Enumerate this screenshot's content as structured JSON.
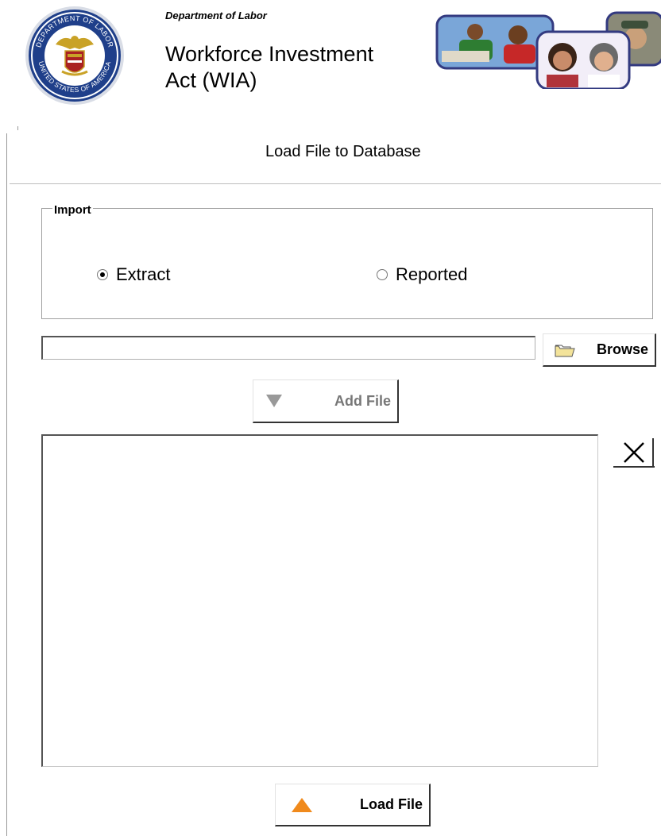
{
  "header": {
    "seal_text_top": "DEPARTMENT OF LABOR",
    "seal_text_bottom": "UNITED STATES OF AMERICA",
    "department": "Department of Labor",
    "title_line1": "Workforce Investment",
    "title_line2": "Act (WIA)"
  },
  "form": {
    "title": "Load File to Database",
    "import_group": {
      "legend": "Import",
      "options": [
        {
          "label": "Extract",
          "selected": true
        },
        {
          "label": "Reported",
          "selected": false
        }
      ]
    },
    "path_input": {
      "value": "",
      "placeholder": ""
    },
    "browse_label": "Browse",
    "add_file_label": "Add File",
    "file_list": [],
    "load_file_label": "Load File"
  },
  "colors": {
    "accent_load_arrow": "#f08a1c",
    "disabled_text": "#777777",
    "seal_navy": "#1f3f8a",
    "seal_gold": "#c9a227"
  }
}
